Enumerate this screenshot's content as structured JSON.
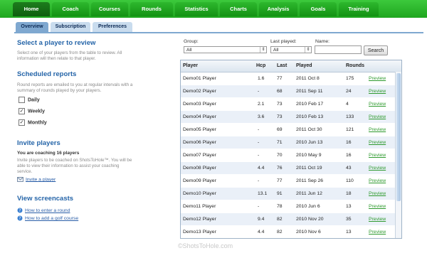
{
  "nav": {
    "tabs": [
      {
        "label": "Home",
        "active": true
      },
      {
        "label": "Coach",
        "active": false
      },
      {
        "label": "Courses",
        "active": false
      },
      {
        "label": "Rounds",
        "active": false
      },
      {
        "label": "Statistics",
        "active": false
      },
      {
        "label": "Charts",
        "active": false
      },
      {
        "label": "Analysis",
        "active": false
      },
      {
        "label": "Goals",
        "active": false
      },
      {
        "label": "Training",
        "active": false
      }
    ]
  },
  "subtabs": [
    {
      "label": "Overview",
      "active": true
    },
    {
      "label": "Subscription",
      "active": false
    },
    {
      "label": "Preferences",
      "active": false
    }
  ],
  "select_player": {
    "title": "Select a player to review",
    "text_1": "Select one of your players from the table to review. All",
    "text_2": "information will then relate to that player."
  },
  "reports": {
    "title": "Scheduled reports",
    "text_1": "Round reports are emailed to you at regular intervals with a",
    "text_2": "summary of rounds played by your players.",
    "options": [
      {
        "label": "Daily",
        "checked": false
      },
      {
        "label": "Weekly",
        "checked": true
      },
      {
        "label": "Monthly",
        "checked": true
      }
    ]
  },
  "invite": {
    "title": "Invite players",
    "coaching": "You are coaching 16 players",
    "text_1": "Invite players to be coached on ShotsToHole™. You will be",
    "text_2": "able to view their information to assist your coaching",
    "text_3": "service.",
    "link": "Invite a player"
  },
  "screencasts": {
    "title": "View screencasts",
    "links": [
      "How to enter a round",
      "How to add a golf course"
    ]
  },
  "filters": {
    "group_label": "Group:",
    "group_value": "All",
    "last_played_label": "Last played:",
    "last_played_value": "All",
    "name_label": "Name:",
    "search_button": "Search"
  },
  "table": {
    "headers": [
      "Player",
      "Hcp",
      "Last",
      "Played",
      "Rounds"
    ],
    "preview_label": "Preview",
    "rows": [
      {
        "player": "Demo01 Player",
        "hcp": "1.6",
        "last": "77",
        "played": "2011 Oct 8",
        "rounds": "175"
      },
      {
        "player": "Demo02 Player",
        "hcp": "-",
        "last": "68",
        "played": "2011 Sep 11",
        "rounds": "24"
      },
      {
        "player": "Demo03 Player",
        "hcp": "2.1",
        "last": "73",
        "played": "2010 Feb 17",
        "rounds": "4"
      },
      {
        "player": "Demo04 Player",
        "hcp": "3.6",
        "last": "73",
        "played": "2010 Feb 13",
        "rounds": "133"
      },
      {
        "player": "Demo05 Player",
        "hcp": "-",
        "last": "69",
        "played": "2011 Oct 30",
        "rounds": "121"
      },
      {
        "player": "Demo06 Player",
        "hcp": "-",
        "last": "71",
        "played": "2010 Jun 13",
        "rounds": "16"
      },
      {
        "player": "Demo07 Player",
        "hcp": "-",
        "last": "70",
        "played": "2010 May 9",
        "rounds": "16"
      },
      {
        "player": "Demo08 Player",
        "hcp": "4.4",
        "last": "76",
        "played": "2011 Oct 19",
        "rounds": "43"
      },
      {
        "player": "Demo09 Player",
        "hcp": "-",
        "last": "77",
        "played": "2011 Sep 26",
        "rounds": "110"
      },
      {
        "player": "Demo10 Player",
        "hcp": "13.1",
        "last": "91",
        "played": "2011 Jun 12",
        "rounds": "18"
      },
      {
        "player": "Demo11 Player",
        "hcp": "-",
        "last": "78",
        "played": "2010 Jun 6",
        "rounds": "13"
      },
      {
        "player": "Demo12 Player",
        "hcp": "9.4",
        "last": "82",
        "played": "2010 Nov 20",
        "rounds": "35"
      },
      {
        "player": "Demo13 Player",
        "hcp": "4.4",
        "last": "82",
        "played": "2010 Nov 6",
        "rounds": "13"
      }
    ]
  },
  "footer": "©ShotsToHole.com",
  "colors": {
    "nav_green": "#22aa22",
    "heading_blue": "#2464a8",
    "link_green": "#2e9a2e"
  }
}
